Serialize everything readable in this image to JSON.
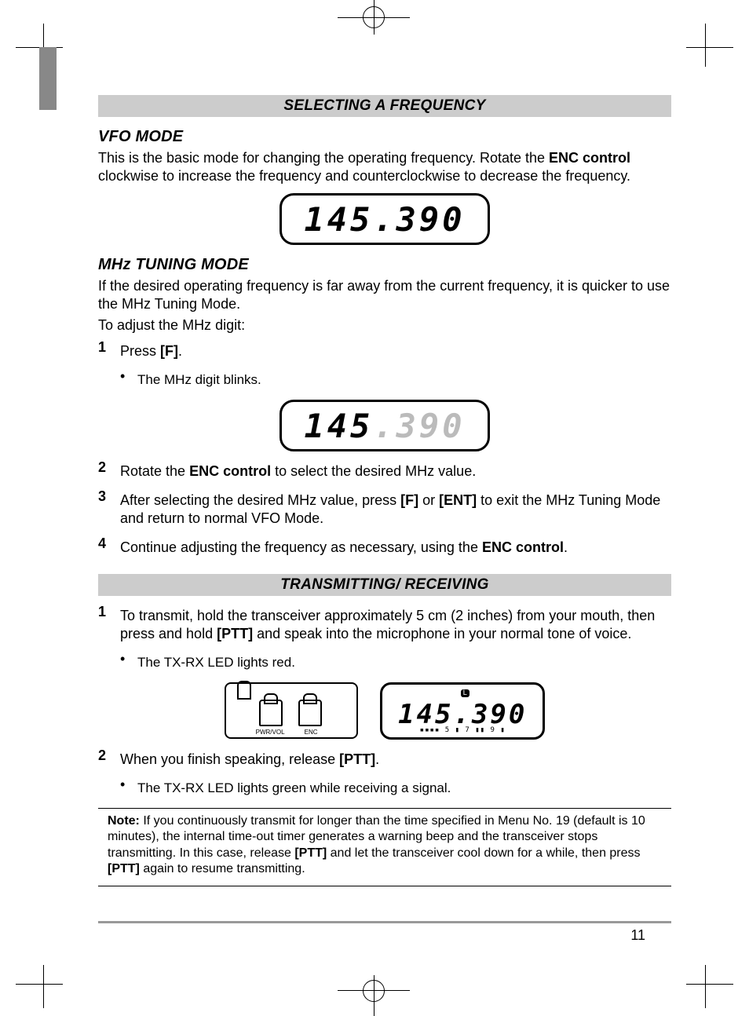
{
  "section1_title": "SELECTING A FREQUENCY",
  "vfo": {
    "heading": "VFO MODE",
    "para_parts": {
      "p1": "This is the basic mode for changing the operating frequency.  Rotate the ",
      "b1": "ENC control",
      "p2": " clockwise to increase the frequency and counterclockwise to decrease the frequency."
    }
  },
  "lcd1_digits": "145.390",
  "mhz": {
    "heading": "MHz TUNING MODE",
    "para1": "If the desired operating frequency is far away from the current frequency, it is quicker to use the MHz Tuning Mode.",
    "para2": "To adjust the MHz digit:",
    "step1": {
      "text_pre": "Press ",
      "b1": "[F]",
      "text_post": "."
    },
    "step1_bullet": "The MHz digit blinks.",
    "lcd2_main": "145",
    "lcd2_ghost": ".390",
    "step2": {
      "pre": "Rotate the ",
      "b1": "ENC control",
      "post": " to select the desired MHz value."
    },
    "step3": {
      "pre": "After selecting the desired MHz value, press ",
      "b1": "[F]",
      "mid": " or ",
      "b2": "[ENT]",
      "post": " to exit the MHz Tuning Mode and return to normal VFO Mode."
    },
    "step4": {
      "pre": "Continue adjusting the frequency as necessary, using the ",
      "b1": "ENC control",
      "post": "."
    }
  },
  "section2_title": "TRANSMITTING/ RECEIVING",
  "tx": {
    "step1": {
      "pre": "To transmit, hold the transceiver approximately 5 cm (2 inches) from your mouth, then press and hold ",
      "b1": "[PTT]",
      "post": " and speak into the microphone in your normal tone of voice."
    },
    "step1_bullet": "The TX-RX LED lights red.",
    "device_labels": {
      "l1": "PWR/VOL",
      "l2": "ENC"
    },
    "lcd3_l": "L",
    "lcd3_digits": "145.390",
    "lcd3_meter": "▪▪▪▪ 5 ▮ 7 ▮▮ 9 ▮",
    "step2": {
      "pre": "When you finish speaking, release ",
      "b1": "[PTT]",
      "post": "."
    },
    "step2_bullet": "The TX-RX LED lights green while receiving a signal."
  },
  "note": {
    "label": "Note:",
    "pre": "  If you continuously transmit for longer than the time specified in Menu No. 19 (default is 10 minutes), the internal time-out timer generates a warning beep and the transceiver stops transmitting. In this case, release ",
    "b1": "[PTT]",
    "mid": " and let the transceiver cool down for a while, then press ",
    "b2": "[PTT]",
    "post": " again to resume transmitting."
  },
  "page_number": "11",
  "step_nums": {
    "n1": "1",
    "n2": "2",
    "n3": "3",
    "n4": "4"
  }
}
